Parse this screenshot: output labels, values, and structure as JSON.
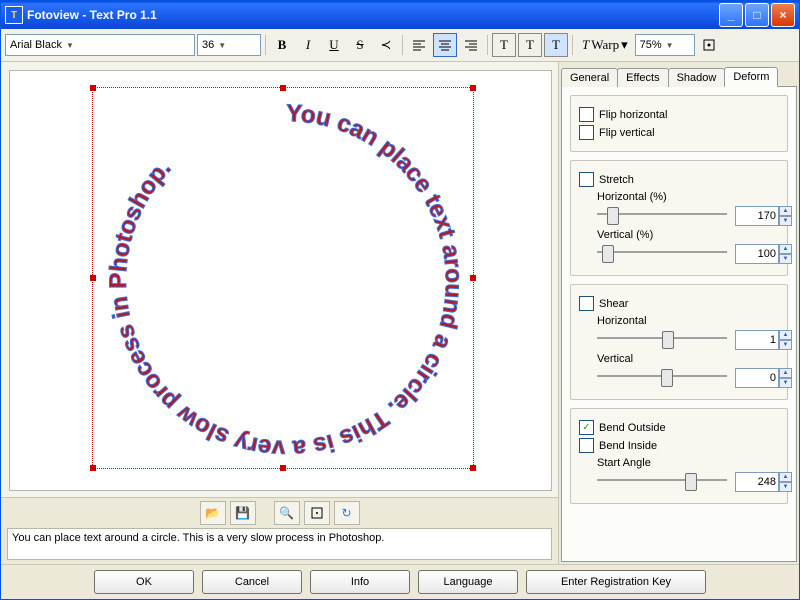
{
  "window": {
    "title": "Fotoview - Text Pro 1.1"
  },
  "toolbar": {
    "font": "Arial Black",
    "size": "36",
    "warp_label": "Warp",
    "zoom": "75%"
  },
  "canvas": {
    "circle_text": "You can place text around a circle. This is a very slow process in Photoshop. "
  },
  "textarea": "You can place text around a circle. This is a very slow process in Photoshop.",
  "tabs": {
    "general": "General",
    "effects": "Effects",
    "shadow": "Shadow",
    "deform": "Deform"
  },
  "deform": {
    "flip_h": "Flip horizontal",
    "flip_v": "Flip vertical",
    "stretch": "Stretch",
    "stretch_h_label": "Horizontal (%)",
    "stretch_h_value": "170",
    "stretch_v_label": "Vertical (%)",
    "stretch_v_value": "100",
    "shear": "Shear",
    "shear_h_label": "Horizontal",
    "shear_h_value": "1",
    "shear_v_label": "Vertical",
    "shear_v_value": "0",
    "bend_out": "Bend Outside",
    "bend_in": "Bend Inside",
    "start_angle_label": "Start Angle",
    "start_angle_value": "248"
  },
  "footer": {
    "ok": "OK",
    "cancel": "Cancel",
    "info": "Info",
    "language": "Language",
    "register": "Enter Registration Key"
  },
  "colors": {
    "text_fill": "#b51923",
    "text_stroke": "#3f6fd8"
  }
}
